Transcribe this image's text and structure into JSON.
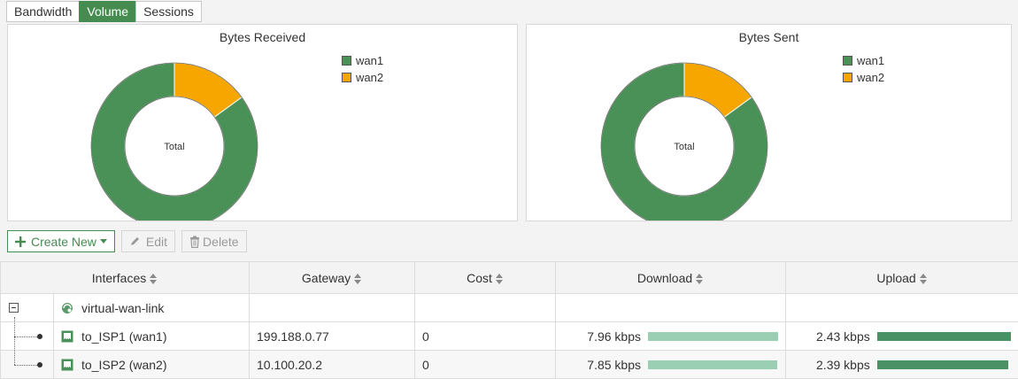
{
  "tabs": [
    {
      "label": "Bandwidth",
      "active": false
    },
    {
      "label": "Volume",
      "active": true
    },
    {
      "label": "Sessions",
      "active": false
    }
  ],
  "colors": {
    "wan1": "#4a9158",
    "wan2": "#f7a600",
    "accent": "#468c50",
    "download_bar": "#9bcfb3",
    "upload_bar": "#4a9166"
  },
  "charts": [
    {
      "title": "Bytes Received",
      "center_label": "Total",
      "legend": [
        {
          "label": "wan1",
          "color": "#4a9158"
        },
        {
          "label": "wan2",
          "color": "#f7a600"
        }
      ]
    },
    {
      "title": "Bytes Sent",
      "center_label": "Total",
      "legend": [
        {
          "label": "wan1",
          "color": "#4a9158"
        },
        {
          "label": "wan2",
          "color": "#f7a600"
        }
      ]
    }
  ],
  "chart_data": [
    {
      "type": "pie",
      "title": "Bytes Received",
      "categories": [
        "wan1",
        "wan2"
      ],
      "values": [
        85,
        15
      ],
      "colors": [
        "#4a9158",
        "#f7a600"
      ],
      "legend": "top-right"
    },
    {
      "type": "pie",
      "title": "Bytes Sent",
      "categories": [
        "wan1",
        "wan2"
      ],
      "values": [
        85,
        15
      ],
      "colors": [
        "#4a9158",
        "#f7a600"
      ],
      "legend": "top-right"
    }
  ],
  "toolbar": {
    "create_new": "Create New",
    "edit": "Edit",
    "delete": "Delete"
  },
  "table": {
    "headers": [
      "Interfaces",
      "Gateway",
      "Cost",
      "Download",
      "Upload"
    ],
    "group": {
      "name": "virtual-wan-link"
    },
    "rows": [
      {
        "interface": "to_ISP1 (wan1)",
        "gateway": "199.188.0.77",
        "cost": "0",
        "download": "7.96 kbps",
        "download_fraction": 1.0,
        "upload": "2.43 kbps",
        "upload_fraction": 1.0
      },
      {
        "interface": "to_ISP2 (wan2)",
        "gateway": "10.100.20.2",
        "cost": "0",
        "download": "7.85 kbps",
        "download_fraction": 0.99,
        "upload": "2.39 kbps",
        "upload_fraction": 0.98
      }
    ]
  }
}
